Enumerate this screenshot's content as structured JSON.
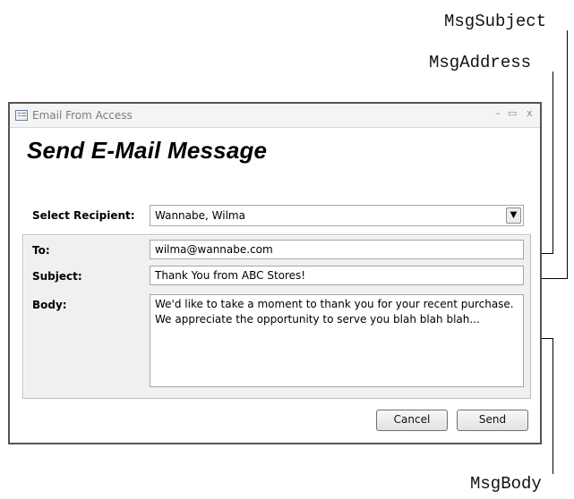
{
  "callouts": {
    "subject": "MsgSubject",
    "address": "MsgAddress",
    "body": "MsgBody"
  },
  "window": {
    "title": "Email From Access",
    "controls": {
      "minimize": "–",
      "maximize": "▭",
      "close": "x"
    }
  },
  "form": {
    "heading": "Send E-Mail Message",
    "recipient": {
      "label": "Select Recipient:",
      "value": "Wannabe, Wilma",
      "dropdown_icon": "chevron-down-icon"
    },
    "to": {
      "label": "To:",
      "value": "wilma@wannabe.com"
    },
    "subject": {
      "label": "Subject:",
      "value": "Thank You from ABC Stores!"
    },
    "body": {
      "label": "Body:",
      "value": "We'd like to take a moment to thank you for your recent purchase.  We appreciate the opportunity to serve you blah blah blah..."
    },
    "buttons": {
      "cancel": "Cancel",
      "send": "Send"
    }
  },
  "colors": {
    "window_border": "#545454",
    "detail_background": "#f0f0f0",
    "title_text": "#7c7c7c"
  }
}
